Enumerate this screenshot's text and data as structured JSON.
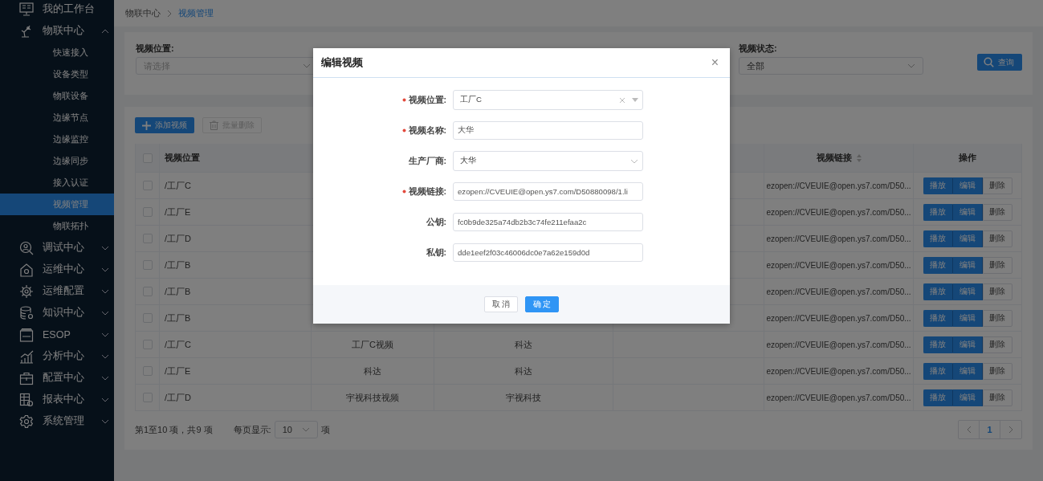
{
  "sidebar": {
    "items": [
      {
        "label": "我的工作台"
      },
      {
        "label": "物联中心",
        "expanded": true,
        "children": [
          {
            "label": "快速接入",
            "selected": false
          },
          {
            "label": "设备类型",
            "selected": false
          },
          {
            "label": "物联设备",
            "selected": false
          },
          {
            "label": "边缘节点",
            "selected": false
          },
          {
            "label": "边缘监控",
            "selected": false
          },
          {
            "label": "边缘同步",
            "selected": false
          },
          {
            "label": "接入认证",
            "selected": false
          },
          {
            "label": "视频管理",
            "selected": true
          },
          {
            "label": "物联拓扑",
            "selected": false
          }
        ]
      },
      {
        "label": "调试中心",
        "expanded": false
      },
      {
        "label": "运维中心",
        "expanded": false
      },
      {
        "label": "运维配置",
        "expanded": false
      },
      {
        "label": "知识中心",
        "expanded": false
      },
      {
        "label": "ESOP",
        "expanded": false
      },
      {
        "label": "分析中心",
        "expanded": false
      },
      {
        "label": "配置中心",
        "expanded": false
      },
      {
        "label": "报表中心",
        "expanded": false
      },
      {
        "label": "系统管理",
        "expanded": false
      }
    ]
  },
  "breadcrumb": [
    "物联中心",
    "视频管理"
  ],
  "filters": {
    "location": {
      "label": "视频位置:",
      "placeholder": "请选择"
    },
    "status": {
      "label": "视频状态:",
      "value": "全部"
    },
    "query_button": "查询"
  },
  "toolbar": [
    {
      "label": "添加视频",
      "kind": "add",
      "disabled": false
    },
    {
      "label": "批量删除",
      "kind": "delete",
      "disabled": true
    }
  ],
  "table": {
    "all_checked": false,
    "columns": [
      {
        "label": "视频位置"
      },
      {
        "label": "视频链接",
        "sortable": true
      },
      {
        "label": "操作"
      }
    ],
    "rows": [
      {
        "location": "/工厂C",
        "link": "ezopen://CVEUIE@open.ys7.com/D50...",
        "checked": false,
        "actions": [
          "播放",
          "编辑",
          "删除"
        ]
      },
      {
        "location": "/工厂E",
        "link": "ezopen://CVEUIE@open.ys7.com/D50...",
        "checked": false,
        "actions": [
          "播放",
          "编辑",
          "删除"
        ]
      },
      {
        "location": "/工厂D",
        "link": "ezopen://CVEUIE@open.ys7.com/D50...",
        "checked": false,
        "actions": [
          "播放",
          "编辑",
          "删除"
        ]
      },
      {
        "location": "/工厂B",
        "link": "ezopen://CVEUIE@open.ys7.com/D50...",
        "checked": false,
        "actions": [
          "播放",
          "编辑",
          "删除"
        ]
      },
      {
        "location": "/工厂B",
        "link": "ezopen://CVEUIE@open.ys7.com/D50...",
        "checked": false,
        "actions": [
          "播放",
          "编辑",
          "删除"
        ]
      },
      {
        "location": "/工厂B",
        "link": "ezopen://CVEUIE@open.ys7.com/D50...",
        "checked": false,
        "actions": [
          "播放",
          "编辑",
          "删除"
        ]
      },
      {
        "location": "/工厂C",
        "column_2": "工厂C视频",
        "column_3": "科达",
        "link": "ezopen://CVEUIE@open.ys7.com/D50...",
        "checked": false,
        "actions": [
          "播放",
          "编辑",
          "删除"
        ]
      },
      {
        "location": "/工厂E",
        "column_2": "科达",
        "column_3": "科达",
        "link": "ezopen://CVEUIE@open.ys7.com/D50...",
        "checked": false,
        "actions": [
          "播放",
          "编辑",
          "删除"
        ]
      },
      {
        "location": "/工厂D",
        "column_2": "宇视科技视频",
        "column_3": "宇视科技",
        "link": "ezopen://CVEUIE@open.ys7.com/D50...",
        "checked": false,
        "actions": [
          "播放",
          "编辑",
          "删除"
        ]
      }
    ]
  },
  "pagination": {
    "summary": "第1至10 项，共9 项",
    "page_size_label": "每页显示:",
    "page_size": "10",
    "page_size_unit": "项",
    "pages": [
      {
        "label": "1",
        "selected": true
      }
    ]
  },
  "dialog": {
    "title": "编辑视频",
    "close": "×",
    "fields": [
      {
        "kind": "select",
        "label": "视频位置:",
        "required": true,
        "value": "工厂C",
        "clearable": true
      },
      {
        "kind": "input",
        "label": "视频名称:",
        "required": true,
        "value": "大华"
      },
      {
        "kind": "select",
        "label": "生产厂商:",
        "value": "大华"
      },
      {
        "kind": "input",
        "label": "视频链接:",
        "required": true,
        "value": "ezopen://CVEUIE@open.ys7.com/D50880098/1.li"
      },
      {
        "kind": "input",
        "label": "公钥:",
        "value": "fc0b9de325a74db2b3c74fe211efaa2c"
      },
      {
        "kind": "input",
        "label": "私钥:",
        "value": "dde1eef2f03c46006dc0e7a62e159d0d"
      }
    ],
    "buttons": [
      {
        "label": "取 消",
        "kind": "cancel"
      },
      {
        "label": "确 定",
        "kind": "primary"
      }
    ]
  }
}
